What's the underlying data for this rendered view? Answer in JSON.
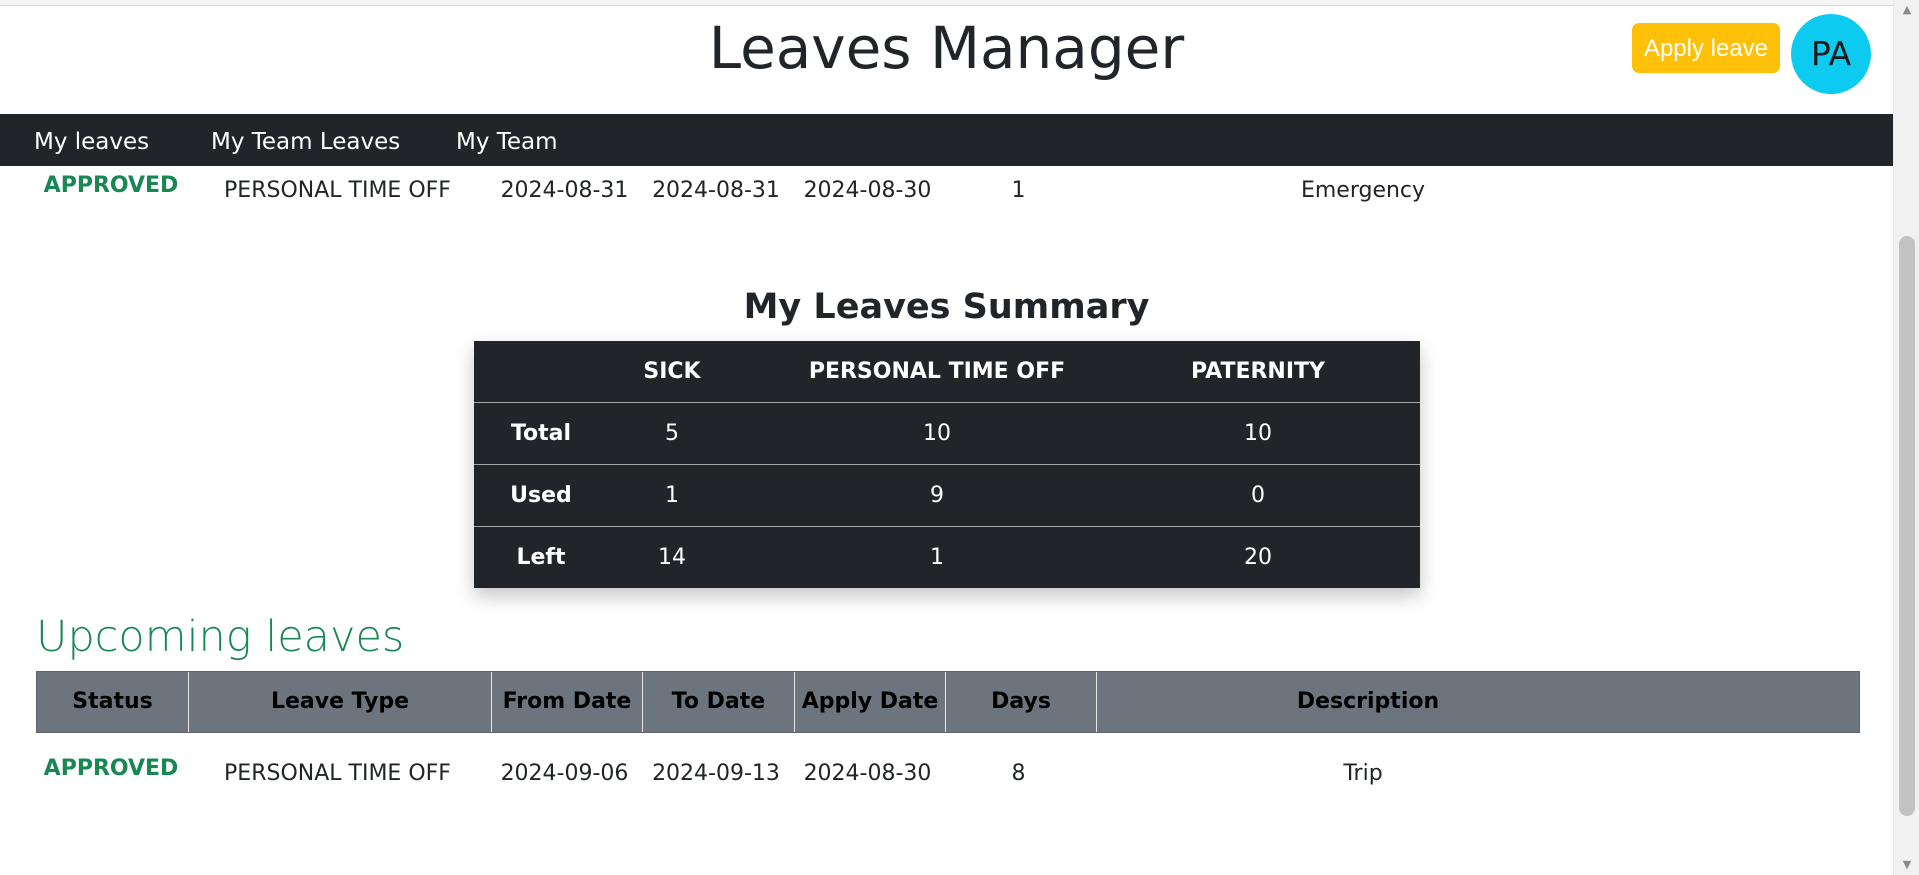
{
  "header": {
    "title": "Leaves Manager",
    "apply_label": "Apply leave",
    "avatar_initials": "PA"
  },
  "nav": {
    "items": [
      "My leaves",
      "My Team Leaves",
      "My Team"
    ]
  },
  "previous_row": {
    "status": "APPROVED",
    "leave_type": "PERSONAL TIME OFF",
    "from": "2024-08-31",
    "to": "2024-08-31",
    "apply": "2024-08-30",
    "days": "1",
    "description": "Emergency"
  },
  "summary": {
    "title": "My Leaves Summary",
    "columns": [
      "SICK",
      "PERSONAL TIME OFF",
      "PATERNITY"
    ],
    "rows": [
      {
        "label": "Total",
        "values": [
          "5",
          "10",
          "10"
        ]
      },
      {
        "label": "Used",
        "values": [
          "1",
          "9",
          "0"
        ]
      },
      {
        "label": "Left",
        "values": [
          "14",
          "1",
          "20"
        ]
      }
    ]
  },
  "upcoming": {
    "title": "Upcoming leaves",
    "headers": [
      "Status",
      "Leave Type",
      "From Date",
      "To Date",
      "Apply Date",
      "Days",
      "Description"
    ],
    "rows": [
      {
        "status": "APPROVED",
        "leave_type": "PERSONAL TIME OFF",
        "from": "2024-09-06",
        "to": "2024-09-13",
        "apply": "2024-08-30",
        "days": "8",
        "description": "Trip"
      }
    ]
  },
  "colors": {
    "navbar": "#212529",
    "approved": "#198754",
    "apply_button": "#ffc107",
    "avatar": "#0dcaf0",
    "table_header": "#6c757d"
  }
}
